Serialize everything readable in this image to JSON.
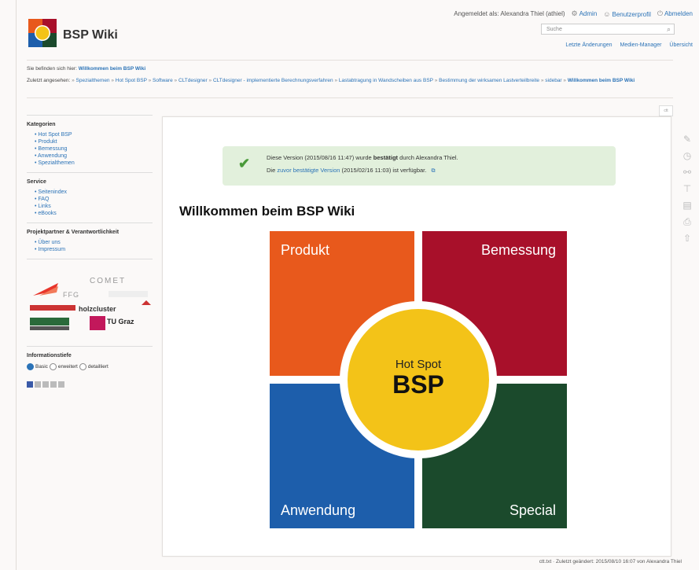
{
  "header": {
    "title": "BSP Wiki",
    "user_tools": [
      {
        "icon": "user-icon",
        "label": "Angemeldet als: Alexandra Thiel (athiel)"
      },
      {
        "icon": "admin-icon",
        "label": "Admin"
      },
      {
        "icon": "profile-icon",
        "label": "Benutzerprofil"
      },
      {
        "icon": "logout-icon",
        "label": "Abmelden"
      }
    ],
    "search_placeholder": "Suche",
    "site_tools": [
      "Letzte Änderungen",
      "Medien-Manager",
      "Übersicht"
    ]
  },
  "breadcrumb": {
    "prefix": "Sie befinden sich hier:",
    "current": "Willkommen beim BSP Wiki"
  },
  "trace": {
    "prefix": "Zuletzt angesehen:",
    "items": [
      "Spezialthemen",
      "Hot Spot BSP",
      "Software",
      "CLTdesigner",
      "CLTdesigner - implementierte Berechnungsverfahren",
      "Lastabtragung in Wandscheiben aus BSP",
      "Bestimmung der wirksamen Lastverteilbreite",
      "sidebar"
    ],
    "current": "Willkommen beim BSP Wiki"
  },
  "sidebar": {
    "sections": [
      {
        "title": "Kategorien",
        "items": [
          "Hot Spot BSP",
          "Produkt",
          "Bemessung",
          "Anwendung",
          "Spezialthemen"
        ]
      },
      {
        "title": "Service",
        "items": [
          "Seitenindex",
          "FAQ",
          "Links",
          "eBooks"
        ]
      },
      {
        "title": "Projektpartner & Verantwortlichkeit",
        "items": [
          "Über uns",
          "Impressum"
        ]
      }
    ],
    "partners": [
      "COMET",
      "FFG",
      "holzcluster",
      "TU Graz"
    ],
    "info_title": "Informationstiefe",
    "depth_options": [
      "Basic",
      "erweitert",
      "detailliert"
    ],
    "depth_selected": "Basic"
  },
  "page": {
    "page_marker": "ctt",
    "notice_line1_a": "Diese Version (2015/08/16 11:47) wurde",
    "notice_line1_b": "bestätigt",
    "notice_line1_c": "durch Alexandra Thiel.",
    "notice_line2_a": "Die",
    "notice_line2_link": "zuvor bestätigte Version",
    "notice_line2_b": "(2015/02/16 11:03) ist verfügbar.",
    "title": "Willkommen beim BSP Wiki",
    "quadrants": {
      "produkt": "Produkt",
      "bemessung": "Bemessung",
      "anwendung": "Anwendung",
      "special": "Special"
    },
    "center_small": "Hot Spot",
    "center_big": "BSP"
  },
  "footer": {
    "text": "ctt.txt · Zuletzt geändert: 2015/08/10 16:07 von Alexandra Thiel"
  },
  "colors": {
    "produkt": "#e8591c",
    "bemessung": "#a8102a",
    "anwendung": "#1d5eab",
    "special": "#1b4a2c",
    "center": "#f3c318",
    "link": "#2b73b7"
  }
}
